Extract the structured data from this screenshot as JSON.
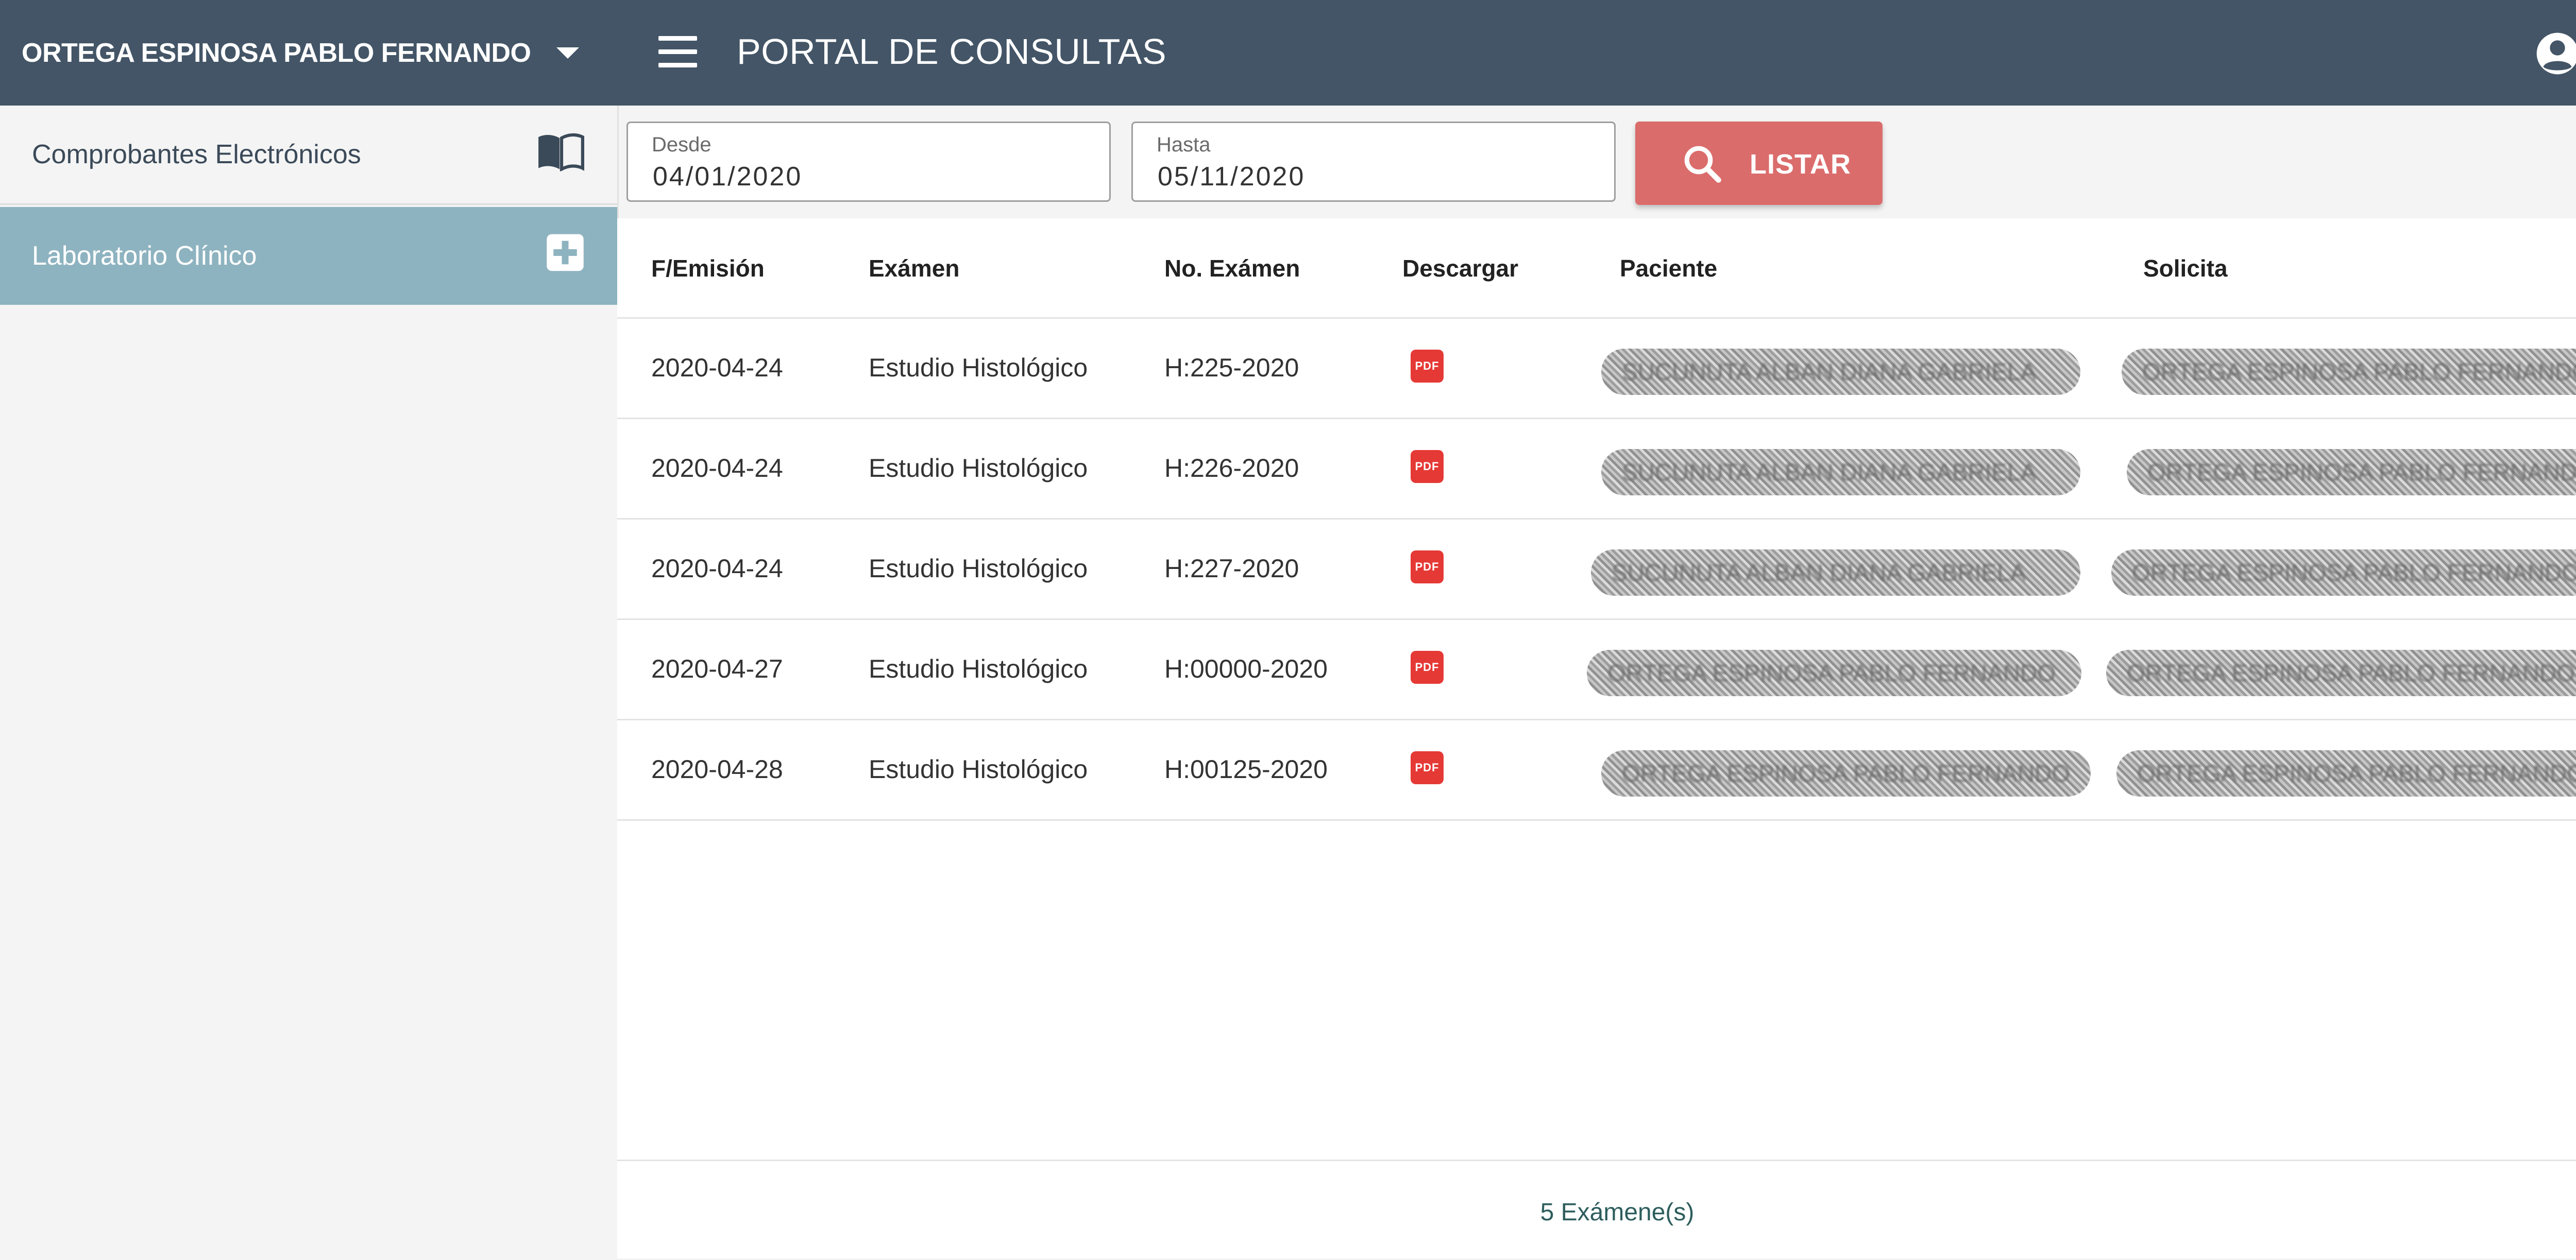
{
  "sidebar": {
    "user_name": "ORTEGA ESPINOSA PABLO FERNANDO",
    "items": [
      {
        "label": "Comprobantes Electrónicos",
        "icon": "book-open-icon"
      },
      {
        "label": "Laboratorio Clínico",
        "icon": "plus-box-icon",
        "active": true
      }
    ]
  },
  "header": {
    "title": "PORTAL DE CONSULTAS"
  },
  "filters": {
    "desde_label": "Desde",
    "desde_value": "04/01/2020",
    "hasta_label": "Hasta",
    "hasta_value": "05/11/2020",
    "listar_label": "LISTAR"
  },
  "table": {
    "columns": [
      "F/Emisión",
      "Exámen",
      "No. Exámen",
      "Descargar",
      "Paciente",
      "Solicita"
    ],
    "rows": [
      {
        "fecha": "2020-04-24",
        "examen": "Estudio Histológico",
        "numero": "H:225-2020",
        "descargar": "PDF",
        "paciente": "SUCUNUTA ALBAN DIANA GABRIELA",
        "solicita": "ORTEGA ESPINOSA PABLO FERNANDO"
      },
      {
        "fecha": "2020-04-24",
        "examen": "Estudio Histológico",
        "numero": "H:226-2020",
        "descargar": "PDF",
        "paciente": "SUCUNUTA ALBAN DIANA GABRIELA",
        "solicita": "ORTEGA ESPINOSA PABLO FERNANDO"
      },
      {
        "fecha": "2020-04-24",
        "examen": "Estudio Histológico",
        "numero": "H:227-2020",
        "descargar": "PDF",
        "paciente": "SUCUNUTA ALBAN DIANA GABRIELA",
        "solicita": "ORTEGA ESPINOSA PABLO FERNANDO"
      },
      {
        "fecha": "2020-04-27",
        "examen": "Estudio Histológico",
        "numero": "H:00000-2020",
        "descargar": "PDF",
        "paciente": "ORTEGA ESPINOSA PABLO FERNANDO",
        "solicita": "ORTEGA ESPINOSA PABLO FERNANDO"
      },
      {
        "fecha": "2020-04-28",
        "examen": "Estudio Histológico",
        "numero": "H:00125-2020",
        "descargar": "PDF",
        "paciente": "ORTEGA ESPINOSA PABLO FERNANDO",
        "solicita": "ORTEGA ESPINOSA PABLO FERNANDO"
      }
    ],
    "footer": "5 Exámene(s)"
  },
  "colors": {
    "topbar": "#435566",
    "active_nav": "#8eb3c0",
    "listar_button": "#db6c6c",
    "pdf_icon": "#e53935"
  }
}
